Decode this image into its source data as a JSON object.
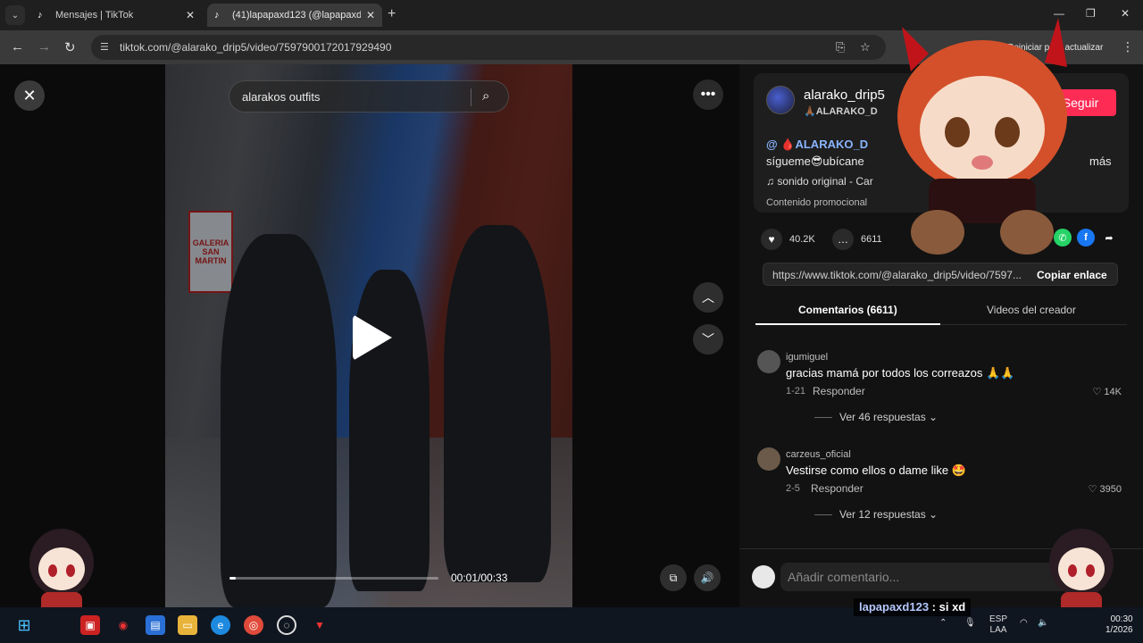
{
  "browser": {
    "tabs": [
      {
        "favicon": "tiktok-icon",
        "title": "Mensajes | TikTok",
        "active": false
      },
      {
        "favicon": "tiktok-icon",
        "title": "(41)lapapaxd123 (@lapapaxd123",
        "active": true
      }
    ],
    "url": "tiktok.com/@alarako_drip5/video/7597900172017929490",
    "update_label": "Reiniciar para actualizar"
  },
  "video": {
    "search_query": "alarakos outfits",
    "time": "00:01/00:33",
    "progress": 0.03,
    "sign_text": [
      "GALERIA",
      "SAN",
      "MARTIN"
    ]
  },
  "panel": {
    "username": "alarako_drip5",
    "nickname": "🙏🏾ALARAKO_D",
    "follow_label": "Seguir",
    "desc_line1": "@ 🩸ALARAKO_D",
    "desc_line2": "sígueme😎ubícane",
    "more_label": "más",
    "music": "♫  sonido original - Car",
    "promo": "Contenido promocional",
    "likes": "40.2K",
    "comments_count": "6611",
    "share_link": "https://www.tiktok.com/@alarako_drip5/video/7597...",
    "copy_label": "Copiar enlace",
    "tab_comments": "Comentarios (6611)",
    "tab_videos": "Videos del creador"
  },
  "comments": [
    {
      "user": "igumiguel",
      "text": "gracias mamá por todos los correazos 🙏🙏",
      "date": "1-21",
      "reply": "Responder",
      "likes": "14K",
      "more": "Ver 46 respuestas ⌄"
    },
    {
      "user": "carzeus_oficial",
      "text": "Vestirse como ellos o dame like 🤩",
      "date": "2-5",
      "reply": "Responder",
      "likes": "3950",
      "more": "Ver 12 respuestas ⌄"
    }
  ],
  "compose_placeholder": "Añadir comentario...",
  "chat": {
    "user": "lapapaxd123",
    "text": ": si xd"
  },
  "taskbar": {
    "lang1": "ESP",
    "lang2": "LAA",
    "time": "00:30",
    "date": "1/2026"
  },
  "colors": {
    "accent": "#fe2c55",
    "panel": "#121212",
    "chrome": "#3a3a3a"
  }
}
